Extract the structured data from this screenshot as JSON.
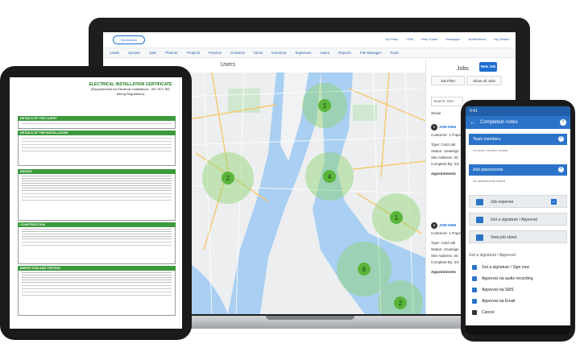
{
  "laptop": {
    "logo": "fieldmotion",
    "top_links": [
      "My Diary",
      "CRM",
      "Help Guide",
      "Messages",
      "Notifications",
      "My Details"
    ],
    "nav": [
      "Leads",
      "Quotes",
      "Jobs",
      "Planner",
      "Projects",
      "Finance",
      "Contacts",
      "Stock",
      "Inventory",
      "Expenses",
      "Users",
      "Reports",
      "File Manager",
      "Tools"
    ],
    "users_title": "Users",
    "jobs": {
      "title": "Jobs",
      "new_job": "New Job",
      "job_filter": "Job Filter",
      "show_all": "Show All Jobs",
      "search_placeholder": "Search Jobs",
      "showing": "Showi",
      "cards": [
        {
          "num": "1",
          "id": "JOB-0064",
          "customer": "Customer: 1 Paps",
          "type": "Type: Cold call",
          "status": "Status: Unassign",
          "site": "Site Address: Sit",
          "complete": "Complete By: 0/1",
          "appts": "Appointments"
        },
        {
          "num": "2",
          "id": "JOB-0065",
          "customer": "Customer: 1 Paps",
          "type": "Type: Cold call",
          "status": "Status: Unassign",
          "site": "Site Address: Sit",
          "complete": "Complete By: 0/1",
          "appts": "Appointments"
        }
      ]
    },
    "map_clusters": [
      "1",
      "2",
      "4",
      "1",
      "6",
      "2"
    ]
  },
  "tablet": {
    "title": "ELECTRICAL INSTALLATION CERTIFICATE",
    "subtitle": "(Requirements for Electrical Installations - BS 7671 IEE Wiring Regulations)",
    "sections": [
      "DETAILS OF THE CLIENT",
      "DETAILS OF THE INSTALLATION",
      "DESIGN",
      "CONSTRUCTION",
      "INSPECTION AND TESTING"
    ]
  },
  "phone": {
    "time": "9:41",
    "app_title": "Completion notes",
    "team_members": "Team members",
    "no_team": "No team member added",
    "add_attachments": "Add attachments",
    "no_attach": "No attachments added",
    "actions": [
      "Job expense",
      "Get a signature / Approval",
      "View job sheet"
    ],
    "expense_count": "0",
    "sheet_title": "Get a signature / Approval",
    "sheet_items": [
      "Get a signature / Sign now",
      "Approval via audio recording",
      "Approval via SMS",
      "Approval via Email",
      "Cancel"
    ]
  }
}
